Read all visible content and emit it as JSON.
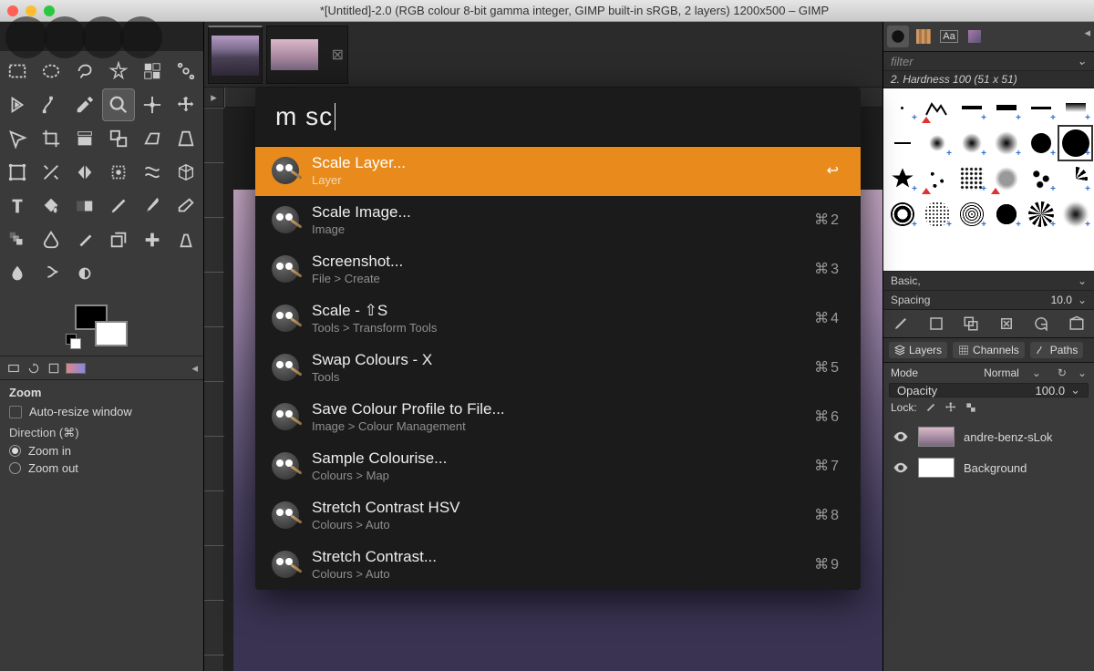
{
  "window": {
    "title": "*[Untitled]-2.0 (RGB colour 8-bit gamma integer, GIMP built-in sRGB, 2 layers) 1200x500 – GIMP"
  },
  "toolbox": {
    "options_title": "Zoom",
    "auto_resize": "Auto-resize window",
    "direction_label": "Direction  (⌘)",
    "zoom_in": "Zoom in",
    "zoom_out": "Zoom out"
  },
  "palette": {
    "query": "m sc",
    "results": [
      {
        "title": "Scale Layer...",
        "sub": "Layer",
        "kbd": "↩",
        "selected": true
      },
      {
        "title": "Scale Image...",
        "sub": "Image",
        "kbd": "⌘2"
      },
      {
        "title": "Screenshot...",
        "sub": "File > Create",
        "kbd": "⌘3"
      },
      {
        "title": "Scale - ⇧S",
        "sub": "Tools > Transform Tools",
        "kbd": "⌘4"
      },
      {
        "title": "Swap Colours - X",
        "sub": "Tools",
        "kbd": "⌘5"
      },
      {
        "title": "Save Colour Profile to File...",
        "sub": "Image > Colour Management",
        "kbd": "⌘6"
      },
      {
        "title": "Sample Colourise...",
        "sub": "Colours > Map",
        "kbd": "⌘7"
      },
      {
        "title": "Stretch Contrast HSV",
        "sub": "Colours > Auto",
        "kbd": "⌘8"
      },
      {
        "title": "Stretch Contrast...",
        "sub": "Colours > Auto",
        "kbd": "⌘9"
      }
    ]
  },
  "right": {
    "filter_placeholder": "filter",
    "brush_label": "2. Hardness 100 (51 x 51)",
    "preset_label": "Basic,",
    "spacing_label": "Spacing",
    "spacing_value": "10.0",
    "layers_tab": "Layers",
    "channels_tab": "Channels",
    "paths_tab": "Paths",
    "mode_label": "Mode",
    "mode_value": "Normal",
    "opacity_label": "Opacity",
    "opacity_value": "100.0",
    "lock_label": "Lock:",
    "layers": [
      {
        "name": "andre-benz-sLok",
        "grad": true
      },
      {
        "name": "Background",
        "grad": false
      }
    ]
  }
}
